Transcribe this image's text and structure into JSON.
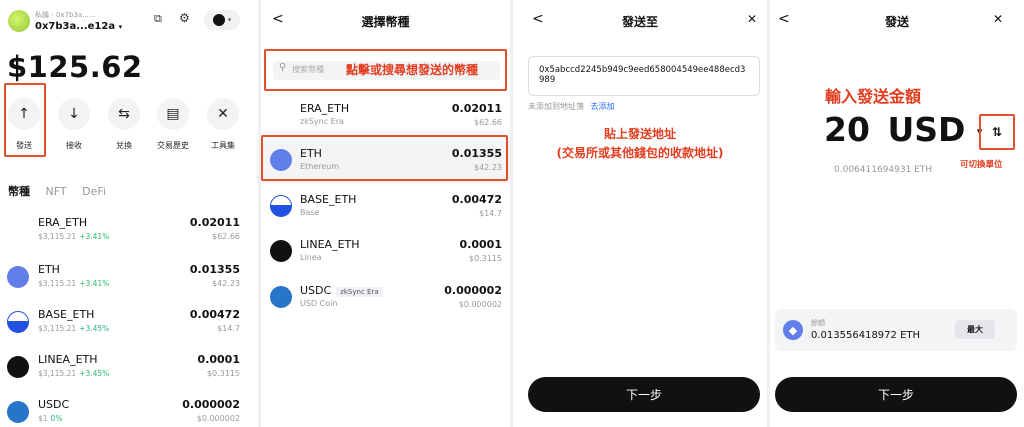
{
  "wallet": {
    "account_label": "私鑰 - 0x7b3a......",
    "address": "0x7b3a...e12a",
    "balance": "$125.62",
    "actions": [
      {
        "label": "發送",
        "icon": "arrow-up-icon",
        "glyph": "↑"
      },
      {
        "label": "接收",
        "icon": "arrow-down-icon",
        "glyph": "↓"
      },
      {
        "label": "兌換",
        "icon": "swap-icon",
        "glyph": "⇆"
      },
      {
        "label": "交易歷史",
        "icon": "history-icon",
        "glyph": "▤"
      },
      {
        "label": "工具集",
        "icon": "tools-icon",
        "glyph": "✕"
      }
    ],
    "tabs": [
      "幣種",
      "NFT",
      "DeFi"
    ],
    "tokens": [
      {
        "name": "ERA_ETH",
        "price": "$3,115.21",
        "change": "+3.41%",
        "amount": "0.02011",
        "value": "$62.66",
        "icon": "era-icon"
      },
      {
        "name": "ETH",
        "price": "$3,115.21",
        "change": "+3.41%",
        "amount": "0.01355",
        "value": "$42.23",
        "icon": "eth-icon"
      },
      {
        "name": "BASE_ETH",
        "price": "$3,115.21",
        "change": "+3.45%",
        "amount": "0.00472",
        "value": "$14.7",
        "icon": "base-icon"
      },
      {
        "name": "LINEA_ETH",
        "price": "$3,115.21",
        "change": "+3.45%",
        "amount": "0.0001",
        "value": "$0.3115",
        "icon": "linea-icon"
      },
      {
        "name": "USDC",
        "price": "$1",
        "change": "0%",
        "amount": "0.000002",
        "value": "$0.000002",
        "icon": "usdc-icon"
      }
    ]
  },
  "select": {
    "back": "<",
    "title": "選擇幣種",
    "search_placeholder": "搜索幣種",
    "annotation": "點擊或搜尋想發送的幣種",
    "tokens": [
      {
        "name": "ERA_ETH",
        "network": "zkSync Era",
        "amount": "0.02011",
        "value": "$62.66",
        "tag": ""
      },
      {
        "name": "ETH",
        "network": "Ethereum",
        "amount": "0.01355",
        "value": "$42.23",
        "tag": ""
      },
      {
        "name": "BASE_ETH",
        "network": "Base",
        "amount": "0.00472",
        "value": "$14.7",
        "tag": ""
      },
      {
        "name": "LINEA_ETH",
        "network": "Linea",
        "amount": "0.0001",
        "value": "$0.3115",
        "tag": ""
      },
      {
        "name": "USDC",
        "network": "USD Coin",
        "amount": "0.000002",
        "value": "$0.000002",
        "tag": "zkSync Era"
      }
    ]
  },
  "sendto": {
    "back": "<",
    "title": "發送至",
    "close": "✕",
    "address": "0x5abccd2245b949c9eed658004549ee488ecd3989",
    "not_added": "未添加到地址簿",
    "add_link": "去添加",
    "annotation_line1": "貼上發送地址",
    "annotation_line2": "(交易所或其他錢包的收款地址)",
    "next": "下一步"
  },
  "amount": {
    "back": "<",
    "title": "發送",
    "close": "✕",
    "annotation": "輸入發送金額",
    "value": "20",
    "unit": "USD",
    "eth_equiv": "0.006411694931 ETH",
    "switch_note": "可切換單位",
    "balance_label": "餘額",
    "balance_value": "0.013556418972 ETH",
    "max_label": "最大",
    "next": "下一步"
  }
}
